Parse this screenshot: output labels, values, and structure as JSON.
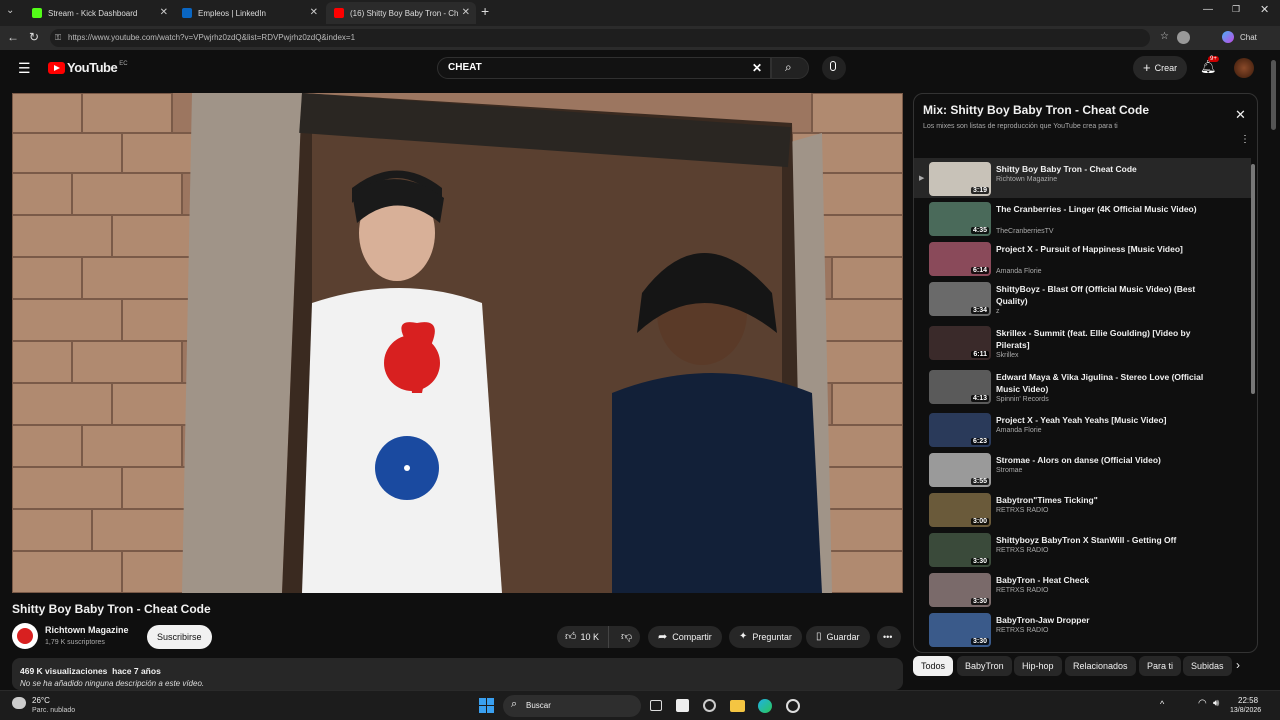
{
  "browser": {
    "tabs": [
      {
        "label": "Stream - Kick Dashboard",
        "color": "#53fc18"
      },
      {
        "label": "Empleos | LinkedIn",
        "color": "#0a66c2"
      },
      {
        "label": "(16) Shitty Boy Baby Tron - Ch",
        "color": "#ff0000"
      }
    ],
    "url": "https://www.youtube.com/watch?v=VPwjrhz0zdQ&list=RDVPwjrhz0zdQ&index=1",
    "chat_label": "Chat"
  },
  "youtube": {
    "logo_text": "YouTube",
    "region": "EC",
    "search_value": "CHEAT",
    "create_label": "Crear",
    "notif_count": "9+"
  },
  "video": {
    "title": "Shitty Boy Baby Tron - Cheat Code",
    "channel": "Richtown Magazine",
    "subscribers": "1,79 K suscriptores",
    "subscribe_label": "Suscribirse",
    "likes": "10 K",
    "share_label": "Compartir",
    "ask_label": "Preguntar",
    "save_label": "Guardar",
    "views_line": "469 K visualizaciones  hace 7 años",
    "description": "No se ha añadido ninguna descripción a este vídeo."
  },
  "playlist": {
    "title": "Mix: Shitty Boy Baby Tron - Cheat Code",
    "subtitle": "Los mixes son listas de reproducción que YouTube crea para ti",
    "items": [
      {
        "title": "Shitty Boy Baby Tron - Cheat Code",
        "channel": "Richtown Magazine",
        "duration": "3:19",
        "thumb": "#c8c2b8"
      },
      {
        "title": "The Cranberries - Linger (4K Official Music Video)",
        "channel": "TheCranberriesTV",
        "duration": "4:35",
        "thumb": "#4a6a5a"
      },
      {
        "title": "Project X - Pursuit of Happiness [Music Video]",
        "channel": "Amanda Florie",
        "duration": "6:14",
        "thumb": "#8a4a5a"
      },
      {
        "title": "ShittyBoyz - Blast Off (Official Music Video) (Best Quality)",
        "channel": "z",
        "duration": "3:34",
        "thumb": "#6a6a6a"
      },
      {
        "title": "Skrillex - Summit (feat. Ellie Goulding) [Video by Pilerats]",
        "channel": "Skrillex",
        "duration": "6:11",
        "thumb": "#3a2a2a"
      },
      {
        "title": "Edward Maya & Vika Jigulina - Stereo Love (Official Music Video)",
        "channel": "Spinnin' Records",
        "duration": "4:13",
        "thumb": "#5a5a5a"
      },
      {
        "title": "Project X - Yeah Yeah Yeahs [Music Video]",
        "channel": "Amanda Florie",
        "duration": "6:23",
        "thumb": "#2a3a5a"
      },
      {
        "title": "Stromae - Alors on danse (Official Video)",
        "channel": "Stromae",
        "duration": "3:55",
        "thumb": "#9a9a9a"
      },
      {
        "title": "Babytron\"Times Ticking\"",
        "channel": "RETRXS RADIO",
        "duration": "3:00",
        "thumb": "#6a5a3a"
      },
      {
        "title": "Shittyboyz BabyTron X StanWill - Getting Off",
        "channel": "RETRXS RADIO",
        "duration": "3:30",
        "thumb": "#3a4a3a"
      },
      {
        "title": "BabyTron - Heat Check",
        "channel": "RETRXS RADIO",
        "duration": "3:30",
        "thumb": "#7a6a6a"
      },
      {
        "title": "BabyTron-Jaw Dropper",
        "channel": "RETRXS RADIO",
        "duration": "3:30",
        "thumb": "#3a5a8a"
      }
    ]
  },
  "chips": [
    "Todos",
    "BabyTron",
    "Hip-hop",
    "Relacionados",
    "Para ti",
    "Subidas"
  ],
  "taskbar": {
    "temperature": "26°C",
    "weather": "Parc. nublado",
    "search_label": "Buscar",
    "time": "22:58",
    "date": "13/8/2026"
  }
}
